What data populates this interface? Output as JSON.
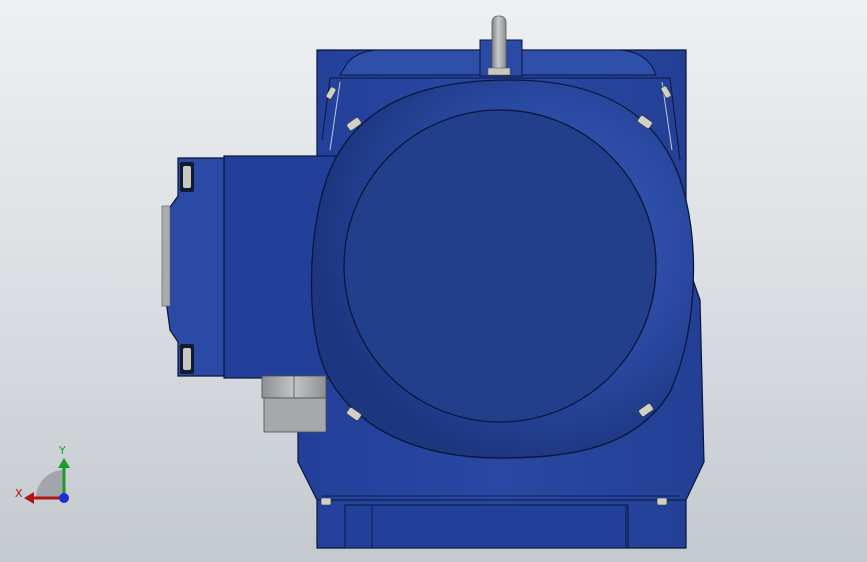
{
  "viewport": {
    "view": "front",
    "colors": {
      "body_blue": "#27459a",
      "body_blue_dark": "#1c3478",
      "body_blue_light": "#3558b0",
      "cover_blue": "#2b48a0",
      "cover_face": "#233f8c",
      "outline": "#0b1638",
      "metal_gray": "#a9abae",
      "bolt_silver": "#d0d0c8"
    }
  },
  "triad": {
    "x_label": "X",
    "y_label": "Y",
    "colors": {
      "x": "#b01818",
      "y": "#1f9a2a",
      "z": "#1c2fd0",
      "arc": "#9a9ea4"
    }
  }
}
